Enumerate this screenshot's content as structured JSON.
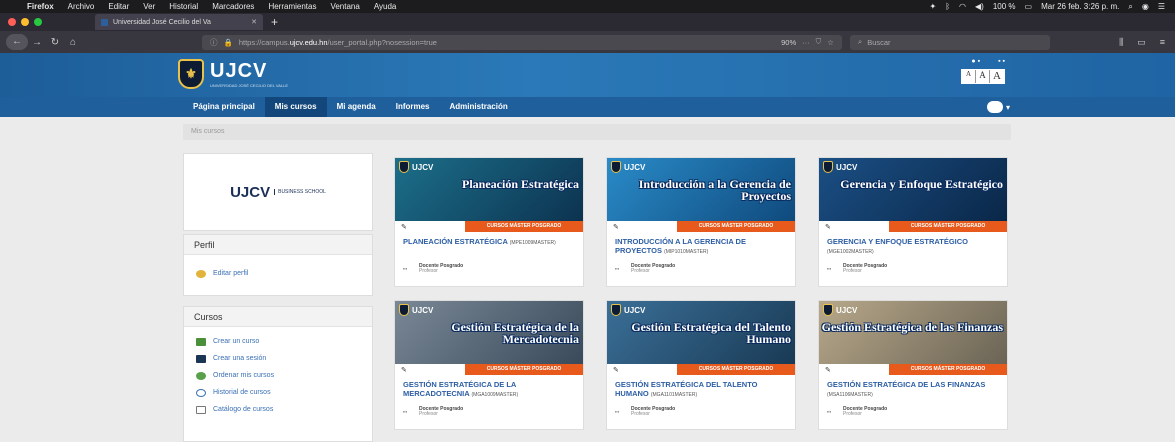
{
  "menubar": {
    "app": "Firefox",
    "items": [
      "Archivo",
      "Editar",
      "Ver",
      "Historial",
      "Marcadores",
      "Herramientas",
      "Ventana",
      "Ayuda"
    ],
    "battery": "100 %",
    "clock": "Mar 26 feb. 3:26 p. m."
  },
  "browser": {
    "tab_title": "Universidad José Cecilio del Va",
    "url_prefix": "https://campus.",
    "url_host": "ujcv.edu.hn",
    "url_path": "/user_portal.php?nosession=true",
    "zoom": "90%",
    "search_placeholder": "Buscar"
  },
  "site": {
    "brand": "UJCV",
    "brand_sub": "UNIVERSIDAD JOSÉ CECILIO DEL VALLE",
    "font_sizes": [
      "A",
      "A",
      "A"
    ],
    "nav": [
      "Página principal",
      "Mis cursos",
      "Mi agenda",
      "Informes",
      "Administración"
    ],
    "breadcrumb": "Mis cursos"
  },
  "sidebar": {
    "logo_text": "UJCV",
    "logo_sub": "BUSINESS SCHOOL",
    "perfil_title": "Perfil",
    "perfil_link": "Editar perfil",
    "cursos_title": "Cursos",
    "cursos_links": [
      "Crear un curso",
      "Crear una sesión",
      "Ordenar mis cursos",
      "Historial de cursos",
      "Catálogo de cursos"
    ]
  },
  "courses": [
    {
      "banner": "Planeación Estratégica",
      "ribbon": "CURSOS MÁSTER POSGRADO",
      "title": "PLANEACIÓN ESTRATÉGICA",
      "code": "(MPE1009MASTER)",
      "teacher": "Docente Posgrado",
      "role": "Profesor",
      "color1": "#1c6f8a",
      "color2": "#0c3350"
    },
    {
      "banner": "Introducción a la Gerencia de Proyectos",
      "ribbon": "CURSOS MÁSTER POSGRADO",
      "title": "INTRODUCCIÓN A LA GERENCIA DE PROYECTOS",
      "code": "(MIP1010MASTER)",
      "teacher": "Docente Posgrado",
      "role": "Profesor",
      "color1": "#2a8bc8",
      "color2": "#0f4a7d"
    },
    {
      "banner": "Gerencia y Enfoque Estratégico",
      "ribbon": "CURSOS MÁSTER POSGRADO",
      "title": "GERENCIA Y ENFOQUE ESTRATÉGICO",
      "code": "(MGE1002MASTER)",
      "teacher": "Docente Posgrado",
      "role": "Profesor",
      "color1": "#1b4f85",
      "color2": "#0a2748"
    },
    {
      "banner": "Gestión Estratégica de la Mercadotecnia",
      "ribbon": "CURSOS MÁSTER POSGRADO",
      "title": "GESTIÓN ESTRATÉGICA DE LA MERCADOTECNIA",
      "code": "(MGA1009MASTER)",
      "teacher": "Docente Posgrado",
      "role": "Profesor",
      "color1": "#7a8896",
      "color2": "#394a5a"
    },
    {
      "banner": "Gestión Estratégica del Talento Humano",
      "ribbon": "CURSOS MÁSTER POSGRADO",
      "title": "GESTIÓN ESTRATÉGICA DEL TALENTO HUMANO",
      "code": "(MGA1101MASTER)",
      "teacher": "Docente Posgrado",
      "role": "Profesor",
      "color1": "#3b6f97",
      "color2": "#193a55"
    },
    {
      "banner": "Gestión Estratégica de las Finanzas",
      "ribbon": "CURSOS MÁSTER POSGRADO",
      "title": "GESTIÓN ESTRATÉGICA DE LAS FINANZAS",
      "code": "(MSA1106MASTER)",
      "teacher": "Docente Posgrado",
      "role": "Profesor",
      "color1": "#b7a88a",
      "color2": "#6b6455"
    }
  ],
  "colors": {
    "header": "#2b79b8",
    "ribbon": "#e8591c",
    "link": "#2c5ea5"
  }
}
